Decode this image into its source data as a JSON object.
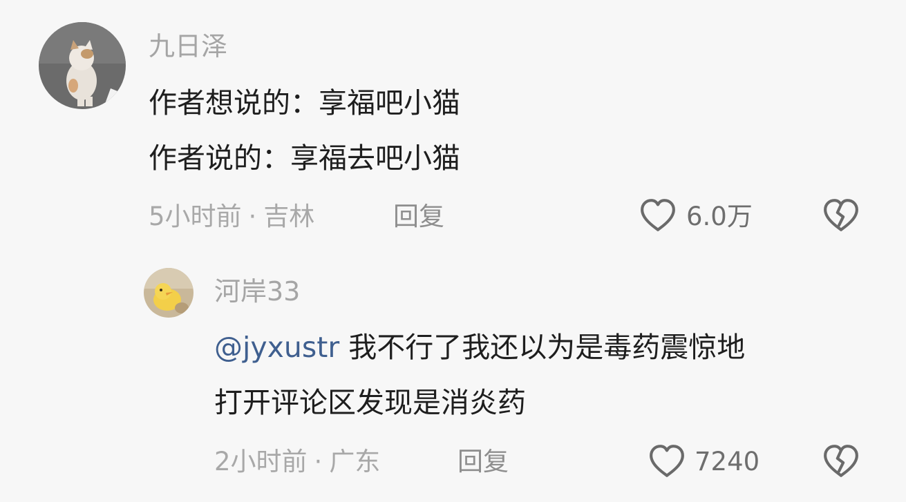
{
  "comments": [
    {
      "username": "九日泽",
      "lines": [
        "作者想说的：享福吧小猫",
        "作者说的：享福去吧小猫"
      ],
      "time": "5小时前",
      "separator": "·",
      "location": "吉林",
      "reply_label": "回复",
      "likes": "6.0万",
      "avatar_icon": "cat-photo-avatar"
    },
    {
      "username": "河岸33",
      "mention": "@jyxustr",
      "line1_text": " 我不行了我还以为是毒药震惊地",
      "line2_text": "打开评论区发现是消炎药",
      "time": "2小时前",
      "separator": "·",
      "location": "广东",
      "reply_label": "回复",
      "likes": "7240",
      "avatar_icon": "yellow-duck-avatar"
    }
  ],
  "icons": {
    "like": "heart-outline-icon",
    "dislike": "broken-heart-icon"
  },
  "colors": {
    "background": "#f7f7f7",
    "mention": "#3f5f8f",
    "text": "#1e1e1e",
    "meta": "#a8a8a8"
  }
}
